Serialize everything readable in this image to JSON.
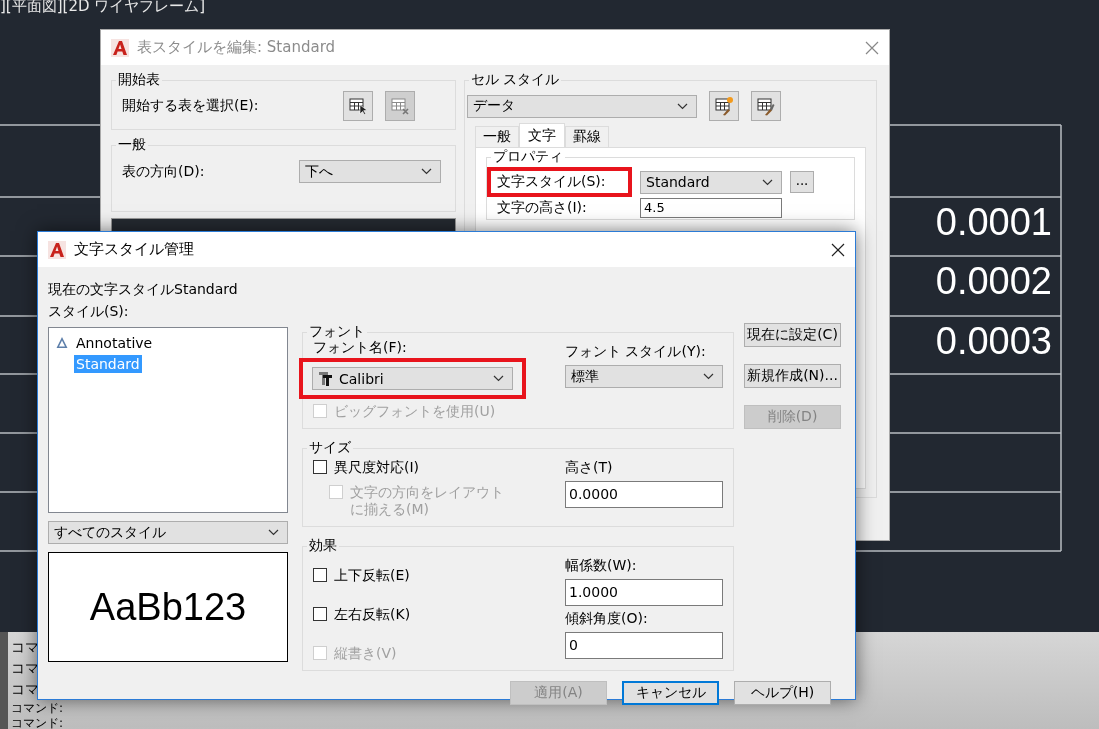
{
  "canvas": {
    "viewport_label": "][平面図][2D ワイヤフレーム]",
    "table_values": [
      "0.0001",
      "0.0002",
      "0.0003"
    ],
    "command_lines": [
      "コマ",
      "コマ",
      "コマ",
      "コマンド:",
      "コマンド:"
    ]
  },
  "back_dialog": {
    "title": "表スタイルを編集: Standard",
    "starting_table": {
      "label": "開始表",
      "prompt": "開始する表を選択(E):"
    },
    "general": {
      "label": "一般",
      "direction_label": "表の方向(D):",
      "direction_value": "下へ"
    },
    "cell_style": {
      "label": "セル スタイル",
      "value": "データ",
      "tabs": [
        {
          "label": "一般",
          "selected": false
        },
        {
          "label": "文字",
          "selected": true
        },
        {
          "label": "罫線",
          "selected": false
        }
      ],
      "properties": {
        "label": "プロパティ",
        "text_style_label": "文字スタイル(S):",
        "text_style_highlighted": true,
        "text_style_value": "Standard",
        "browse_button": "...",
        "text_height_label": "文字の高さ(I):",
        "text_height_value": "4.5"
      }
    }
  },
  "dialog": {
    "title": "文字スタイル管理",
    "current_style": "現在の文字スタイルStandard",
    "styles_label": "スタイル(S):",
    "styles": [
      {
        "name": "Annotative",
        "kind": "annotative",
        "selected": false
      },
      {
        "name": "Standard",
        "kind": "plain",
        "selected": true
      }
    ],
    "filter": "すべてのスタイル",
    "preview": "AaBb123",
    "font": {
      "label": "フォント",
      "name_label": "フォント名(F):",
      "name_value": "Calibri",
      "name_highlighted": true,
      "style_label": "フォント スタイル(Y):",
      "style_value": "標準",
      "big_font": {
        "label": "ビッグフォントを使用(U)",
        "checked": false,
        "disabled": true
      }
    },
    "size": {
      "label": "サイズ",
      "annotative": {
        "label": "異尺度対応(I)",
        "checked": false,
        "disabled": false
      },
      "match_layout": {
        "label_lines": [
          "文字の方向をレイアウト",
          "に揃える(M)"
        ],
        "checked": false,
        "disabled": true
      },
      "height_label": "高さ(T)",
      "height_value": "0.0000"
    },
    "effects": {
      "label": "効果",
      "checks": [
        {
          "label": "上下反転(E)",
          "checked": false,
          "disabled": false
        },
        {
          "label": "左右反転(K)",
          "checked": false,
          "disabled": false
        },
        {
          "label": "縦書き(V)",
          "checked": false,
          "disabled": true
        }
      ],
      "width_label": "幅係数(W):",
      "width_value": "1.0000",
      "oblique_label": "傾斜角度(O):",
      "oblique_value": "0"
    },
    "side_buttons": [
      {
        "label": "現在に設定(C)",
        "disabled": false
      },
      {
        "label": "新規作成(N)...",
        "disabled": false
      },
      {
        "label": "削除(D)",
        "disabled": true
      }
    ],
    "bottom_buttons": [
      {
        "label": "適用(A)",
        "disabled": true,
        "default": false
      },
      {
        "label": "キャンセル",
        "disabled": false,
        "default": true
      },
      {
        "label": "ヘルプ(H)",
        "disabled": false,
        "default": false
      }
    ]
  }
}
